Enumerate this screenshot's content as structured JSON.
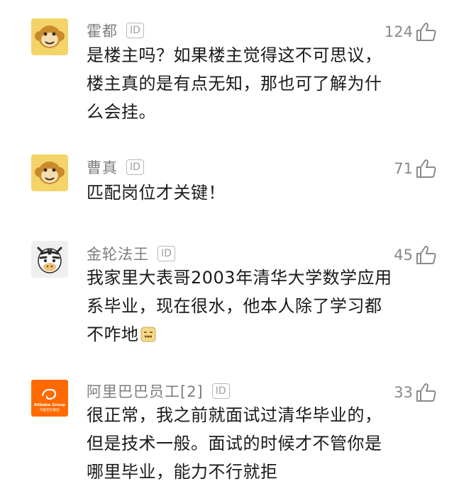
{
  "comments": [
    {
      "username": "霍都",
      "id_badge": "ID",
      "likes": "124",
      "avatar": "monkey-avatar",
      "text": "是楼主吗？如果楼主觉得这不可思议，\n楼主真的是有点无知，那也可了解为什\n么会挂。"
    },
    {
      "username": "曹真",
      "id_badge": "ID",
      "likes": "71",
      "avatar": "monkey-avatar",
      "text": "匹配岗位才关键！"
    },
    {
      "username": "金轮法王",
      "id_badge": "ID",
      "likes": "45",
      "avatar": "zebra-avatar",
      "text": "我家里大表哥2003年清华大学数学应用\n系毕业，现在很水，他本人除了学习都\n不咋地"
    },
    {
      "username": "阿里巴巴员工[2]",
      "id_badge": "ID",
      "likes": "33",
      "avatar": "alibaba-logo-avatar",
      "text": "很正常，我之前就面试过清华毕业的，\n但是技术一般。面试的时候才不管你是\n哪里毕业，能力不行就拒"
    }
  ],
  "avatar_brand_text": {
    "alibaba_logo": "Alibaba Group",
    "alibaba_cn": "阿里巴巴集团"
  },
  "colors": {
    "username": "#7d7d7d",
    "body_text": "#1a1a1a",
    "monkey_bg": "#f4d468",
    "alibaba_orange": "#ff6a00"
  }
}
